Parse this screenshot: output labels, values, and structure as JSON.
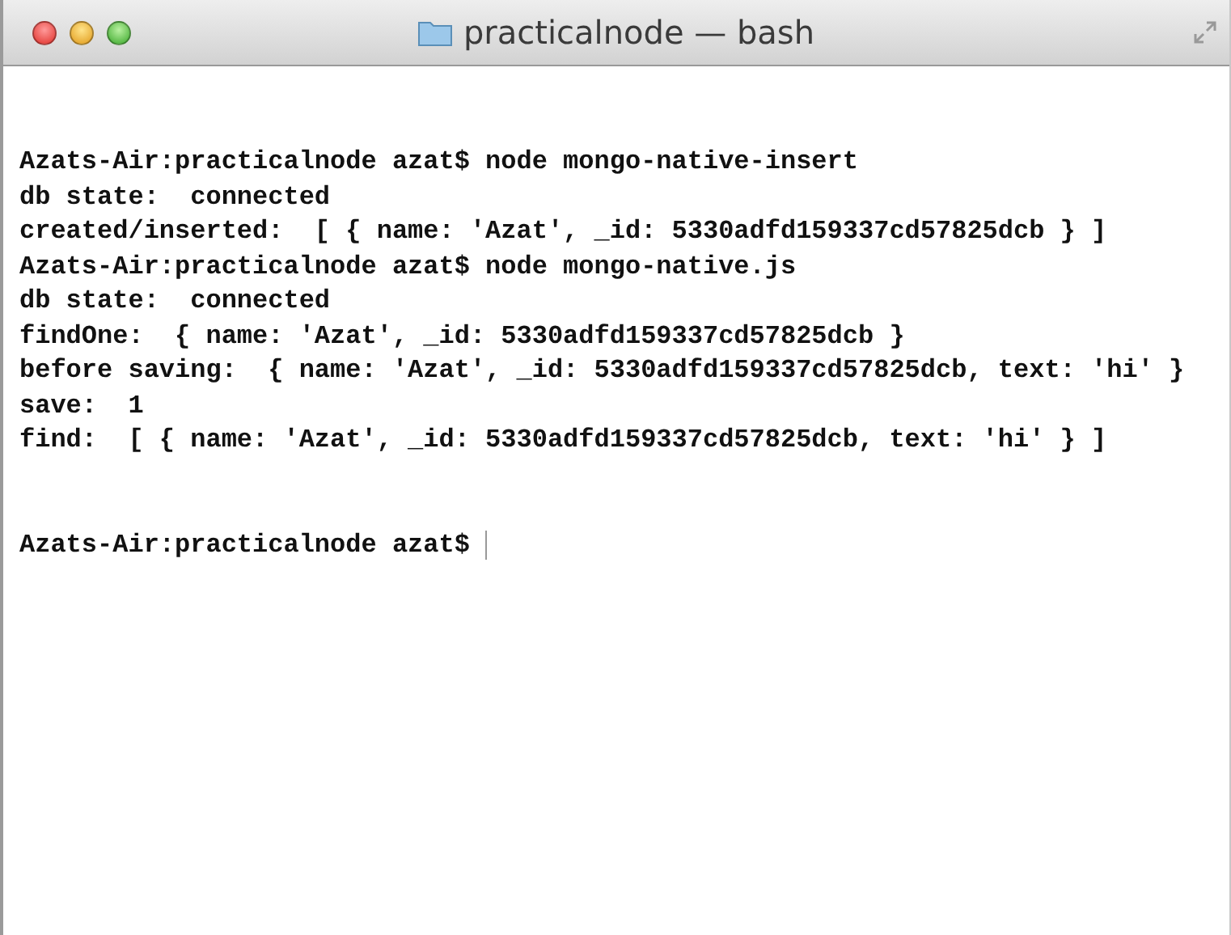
{
  "window": {
    "title": "practicalnode — bash"
  },
  "terminal": {
    "lines": [
      "Azats-Air:practicalnode azat$ node mongo-native-insert",
      "db state:  connected",
      "created/inserted:  [ { name: 'Azat', _id: 5330adfd159337cd57825dcb } ]",
      "Azats-Air:practicalnode azat$ node mongo-native.js",
      "db state:  connected",
      "findOne:  { name: 'Azat', _id: 5330adfd159337cd57825dcb }",
      "before saving:  { name: 'Azat', _id: 5330adfd159337cd57825dcb, text: 'hi' }",
      "save:  1",
      "find:  [ { name: 'Azat', _id: 5330adfd159337cd57825dcb, text: 'hi' } ]"
    ],
    "prompt": "Azats-Air:practicalnode azat$"
  }
}
